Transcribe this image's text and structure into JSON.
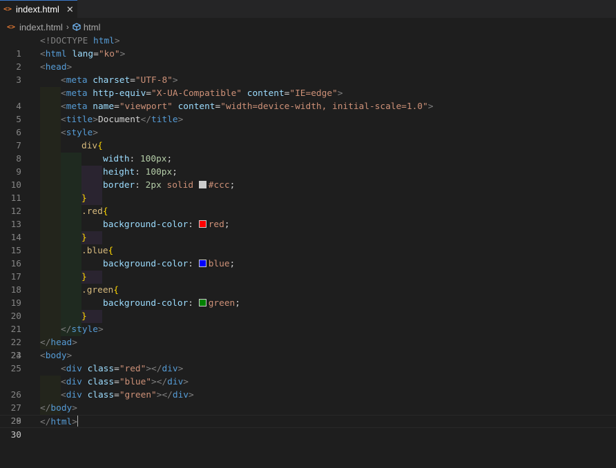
{
  "tab": {
    "filename": "indext.html",
    "close": "✕",
    "icon": "html-file-icon"
  },
  "breadcrumb": {
    "file": "indext.html",
    "separator": "›",
    "symbol": "html"
  },
  "colors": {
    "swatch_ccc": "#cccccc",
    "swatch_red": "#ff0000",
    "swatch_blue": "#0000ff",
    "swatch_green": "#008000"
  },
  "lines": {
    "n1": "1",
    "n2": "2",
    "n3": "3",
    "n4": "4",
    "n5": "5",
    "n6": "6",
    "n7": "7",
    "n8": "8",
    "n9": "9",
    "n10": "10",
    "n11": "11",
    "n12": "12",
    "n13": "13",
    "n14": "14",
    "n15": "15",
    "n16": "16",
    "n17": "17",
    "n18": "18",
    "n19": "19",
    "n20": "20",
    "n21": "21",
    "n22": "22",
    "n23": "23",
    "n24": "24",
    "n25": "25",
    "n26": "26",
    "n27": "27",
    "n28": "28",
    "n29": "29",
    "n30": "30"
  },
  "code": {
    "l1_a": "<!DOCTYPE",
    "l1_b": " html",
    "l1_c": ">",
    "l2_tag": "html",
    "l2_attr": "lang",
    "l2_val": "\"ko\"",
    "l3_tag": "head",
    "l4_tag": "meta",
    "l4_attr": "charset",
    "l4_val": "\"UTF-8\"",
    "l5_tag": "meta",
    "l5_attr1": "http-equiv",
    "l5_val1": "\"X-UA-Compatible\"",
    "l5_attr2": "content",
    "l5_val2": "\"IE=edge\"",
    "l6_tag": "meta",
    "l6_attr1": "name",
    "l6_val1": "\"viewport\"",
    "l6_attr2": "content",
    "l6_val2": "\"width=device-width, initial-scale=1.0\"",
    "l7_tag": "title",
    "l7_text": "Document",
    "l8_tag": "style",
    "l9_sel": "div",
    "l10_prop": "width",
    "l10_val": "100px",
    "l11_prop": "height",
    "l11_val": "100px",
    "l12_prop": "border",
    "l12_num": "2px",
    "l12_solid": "solid",
    "l12_color": "#ccc",
    "l14_sel": ".red",
    "l15_prop": "background-color",
    "l15_val": "red",
    "l17_sel": ".blue",
    "l18_prop": "background-color",
    "l18_val": "blue",
    "l20_sel": ".green",
    "l21_prop": "background-color",
    "l21_val": "green",
    "l23_tag": "style",
    "l24_tag": "head",
    "l25_tag": "body",
    "l26_tag": "div",
    "l26_attr": "class",
    "l26_val": "\"red\"",
    "l27_tag": "div",
    "l27_attr": "class",
    "l27_val": "\"blue\"",
    "l28_tag": "div",
    "l28_attr": "class",
    "l28_val": "\"green\"",
    "l29_tag": "body",
    "l30_tag": "html"
  }
}
